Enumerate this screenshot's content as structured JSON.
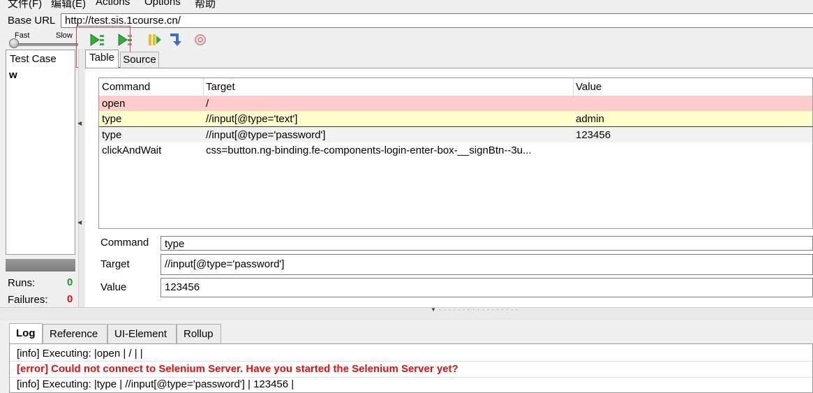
{
  "menu": [
    "文件(F)",
    "编辑(E)",
    "Actions",
    "Options",
    "帮助"
  ],
  "base_url": {
    "label": "Base URL",
    "value": "http://test.sis.1course.cn/"
  },
  "speed": {
    "fast": "Fast",
    "slow": "Slow"
  },
  "toolbar": {
    "icons": [
      "play-all-icon",
      "play-current-icon",
      "pause-icon",
      "step-icon",
      "rollup-icon"
    ]
  },
  "test_case": {
    "header": "Test Case",
    "items": [
      "w"
    ]
  },
  "stats": {
    "runs_label": "Runs:",
    "runs": "0",
    "failures_label": "Failures:",
    "failures": "0"
  },
  "tabs": {
    "table": "Table",
    "source": "Source"
  },
  "table": {
    "headers": [
      "Command",
      "Target",
      "Value"
    ],
    "rows": [
      {
        "command": "open",
        "target": "/",
        "value": "",
        "state": "failed"
      },
      {
        "command": "type",
        "target": "//input[@type='text']",
        "value": "admin",
        "state": "current"
      },
      {
        "command": "type",
        "target": "//input[@type='password']",
        "value": "123456",
        "state": "selected"
      },
      {
        "command": "clickAndWait",
        "target": "css=button.ng-binding.fe-components-login-enter-box-__signBtn--3u...",
        "value": "",
        "state": "none"
      }
    ]
  },
  "detail": {
    "command_label": "Command",
    "command": "type",
    "target_label": "Target",
    "target": "//input[@type='password']",
    "value_label": "Value",
    "value": "123456"
  },
  "log_tabs": [
    "Log",
    "Reference",
    "UI-Element",
    "Rollup"
  ],
  "log": [
    {
      "text": "[info] Executing: |open | / | |",
      "level": "info"
    },
    {
      "text": "[error] Could not connect to Selenium Server. Have you started the Selenium Server yet?",
      "level": "error"
    },
    {
      "text": "[info] Executing: |type | //input[@type='password'] | 123456 |",
      "level": "info"
    }
  ],
  "colors": {
    "failed_row": "#ffcccc",
    "current_row": "#ffffcc",
    "error_text": "#dd1111",
    "runs": "#1a9a1a"
  }
}
